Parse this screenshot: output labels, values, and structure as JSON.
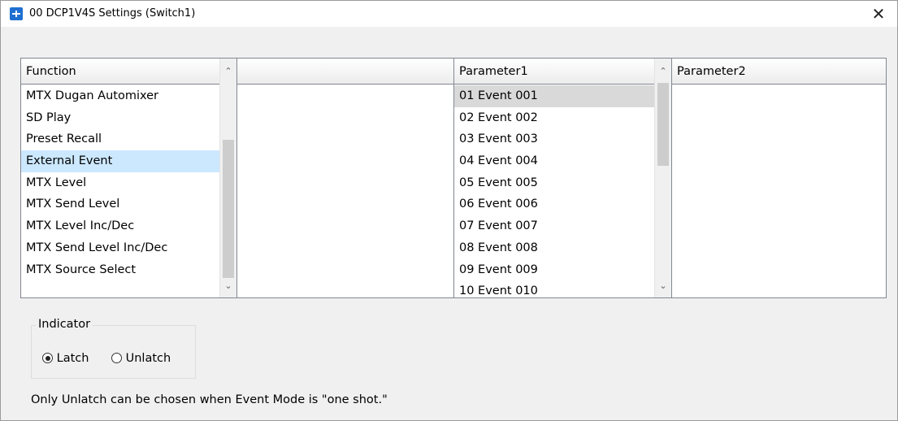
{
  "window": {
    "title": "00 DCP1V4S Settings (Switch1)",
    "close_glyph": "✕"
  },
  "function_list": {
    "header": "Function",
    "items": [
      "MTX Dugan Automixer",
      "SD Play",
      "Preset Recall",
      "External Event",
      "MTX Level",
      "MTX Send Level",
      "MTX Level Inc/Dec",
      "MTX Send Level Inc/Dec",
      "MTX Source Select"
    ],
    "selected": "External Event"
  },
  "blank_list": {
    "header": ""
  },
  "parameter1_list": {
    "header": "Parameter1",
    "items": [
      "01 Event 001",
      "02 Event 002",
      "03 Event 003",
      "04 Event 004",
      "05 Event 005",
      "06 Event 006",
      "07 Event 007",
      "08 Event 008",
      "09 Event 009",
      "10 Event 010"
    ],
    "selected": "01 Event 001"
  },
  "parameter2_list": {
    "header": "Parameter2"
  },
  "indicator": {
    "label": "Indicator",
    "options": [
      "Latch",
      "Unlatch"
    ],
    "selected": "Latch"
  },
  "note": "Only Unlatch can be chosen when Event Mode is \"one shot.\"",
  "icons": {
    "app": "app-icon",
    "close": "close-icon",
    "scroll_up": "chevron-up-icon",
    "scroll_down": "chevron-down-icon"
  },
  "colors": {
    "selected_row": "#cce8ff",
    "current_row": "#d9d9d9",
    "app_icon": "#1f6fd1"
  }
}
